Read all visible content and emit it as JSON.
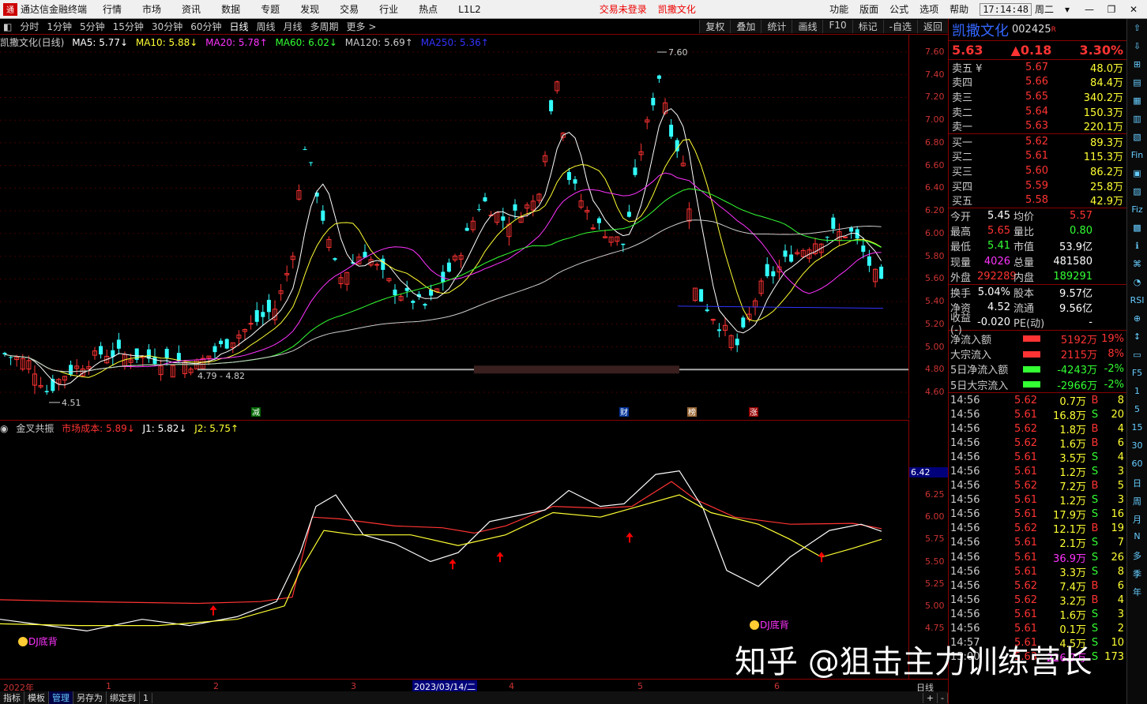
{
  "topbar": {
    "logo": "通",
    "app_name": "通达信金融终端",
    "menus": [
      "行情",
      "市场",
      "资讯",
      "数据",
      "专题",
      "发现",
      "交易",
      "行业",
      "热点",
      "L1L2"
    ],
    "status_login": "交易未登录",
    "status_stock": "凯撒文化",
    "right_menus": [
      "功能",
      "版面",
      "公式",
      "选项",
      "帮助"
    ],
    "time": "17:14:48",
    "weekday": "周二",
    "win_buttons": [
      "▾",
      "—",
      "❐",
      "✕"
    ]
  },
  "periodbar": {
    "toggle": "◧",
    "periods": [
      "分时",
      "1分钟",
      "5分钟",
      "15分钟",
      "30分钟",
      "60分钟",
      "日线",
      "周线",
      "月线",
      "多周期",
      "更多 >"
    ],
    "active": "日线",
    "tools": [
      "复权",
      "叠加",
      "统计",
      "画线",
      "F10",
      "标记",
      "-自选",
      "返回"
    ]
  },
  "ma_line": {
    "name": "凯撒文化(日线)",
    "items": [
      {
        "label": "MA5: 5.77↓",
        "color": "#ffffff"
      },
      {
        "label": "MA10: 5.88↓",
        "color": "#ffff33"
      },
      {
        "label": "MA20: 5.78↑",
        "color": "#ff33ff"
      },
      {
        "label": "MA60: 6.02↓",
        "color": "#33ff33"
      },
      {
        "label": "MA120: 5.69↑",
        "color": "#cccccc"
      },
      {
        "label": "MA250: 5.36↑",
        "color": "#3333ff"
      }
    ]
  },
  "price_axis": [
    "7.60",
    "7.40",
    "7.20",
    "7.00",
    "6.80",
    "6.60",
    "6.40",
    "6.20",
    "6.00",
    "5.80",
    "5.60",
    "5.40",
    "5.20",
    "5.00",
    "4.80",
    "4.60"
  ],
  "annotations": {
    "high": "7.60",
    "low": "4.51",
    "range": "4.79 - 4.82",
    "event_tags": [
      "减",
      "财",
      "榜",
      "涨"
    ]
  },
  "indicator": {
    "toggle": "◉",
    "name": "金叉共振",
    "items": [
      {
        "label": "市场成本: 5.89↓",
        "color": "#ff3333"
      },
      {
        "label": "J1: 5.82↓",
        "color": "#ffffff"
      },
      {
        "label": "J2: 5.75↑",
        "color": "#ffff33"
      }
    ],
    "axis": [
      "6.25",
      "6.00",
      "5.75",
      "5.50",
      "5.25",
      "5.00",
      "4.75"
    ],
    "highlight": "6.42",
    "bottom_signal": "DJ底背"
  },
  "dateaxis": {
    "labels": [
      "2022年",
      "1",
      "2",
      "3",
      "4",
      "5",
      "6"
    ],
    "selected": "2023/03/14/二",
    "period": "日线"
  },
  "bottombar": [
    "指标",
    "模板",
    "管理",
    "另存为",
    "绑定到",
    "1"
  ],
  "bottombar_active": "管理",
  "bottombar_right": [
    "+",
    "-"
  ],
  "quote": {
    "name": "凯撒文化",
    "code": "002425",
    "sup": "R",
    "price": "5.63",
    "change": "▲0.18",
    "pct": "3.30%",
    "sells": [
      {
        "label": "卖五 ¥",
        "price": "5.67",
        "vol": "48.0万"
      },
      {
        "label": "卖四",
        "price": "5.66",
        "vol": "84.4万"
      },
      {
        "label": "卖三",
        "price": "5.65",
        "vol": "340.2万"
      },
      {
        "label": "卖二",
        "price": "5.64",
        "vol": "150.3万"
      },
      {
        "label": "卖一",
        "price": "5.63",
        "vol": "220.1万"
      }
    ],
    "buys": [
      {
        "label": "买一",
        "price": "5.62",
        "vol": "89.3万"
      },
      {
        "label": "买二",
        "price": "5.61",
        "vol": "115.3万"
      },
      {
        "label": "买三",
        "price": "5.60",
        "vol": "86.2万"
      },
      {
        "label": "买四",
        "price": "5.59",
        "vol": "25.8万"
      },
      {
        "label": "买五",
        "price": "5.58",
        "vol": "42.9万"
      }
    ],
    "stats": [
      {
        "a": "今开",
        "b": "5.45",
        "bc": "#ffffff",
        "c": "均价",
        "d": "5.57",
        "dc": "#ff3333"
      },
      {
        "a": "最高",
        "b": "5.65",
        "bc": "#ff3333",
        "c": "量比",
        "d": "0.80",
        "dc": "#33ff33"
      },
      {
        "a": "最低",
        "b": "5.41",
        "bc": "#33ff33",
        "c": "市值",
        "d": "53.9亿",
        "dc": "#ffffff"
      },
      {
        "a": "现量",
        "b": "4026",
        "bc": "#ff33ff",
        "c": "总量",
        "d": "481580",
        "dc": "#ffffff"
      },
      {
        "a": "外盘",
        "b": "292289",
        "bc": "#ff3333",
        "c": "内盘",
        "d": "189291",
        "dc": "#33ff33"
      }
    ],
    "stats2": [
      {
        "a": "换手",
        "b": "5.04%",
        "bc": "#ffffff",
        "c": "股本",
        "d": "9.57亿",
        "dc": "#ffffff"
      },
      {
        "a": "净资",
        "b": "4.52",
        "bc": "#ffffff",
        "c": "流通",
        "d": "9.56亿",
        "dc": "#ffffff"
      },
      {
        "a": "收益(-)",
        "b": "-0.020",
        "bc": "#ffffff",
        "c": "PE(动)",
        "d": "-",
        "dc": "#ffffff"
      }
    ],
    "flows": [
      {
        "l": "净流入额",
        "color": "#ff3333",
        "v": "5192万",
        "p": "19%"
      },
      {
        "l": "大宗流入",
        "color": "#ff3333",
        "v": "2115万",
        "p": "8%"
      },
      {
        "l": "5日净流入额",
        "color": "#33ff33",
        "v": "-4243万",
        "p": "-2%"
      },
      {
        "l": "5日大宗流入",
        "color": "#33ff33",
        "v": "-2966万",
        "p": "-2%"
      }
    ],
    "ticks": [
      [
        "14:56",
        "5.62",
        "0.7万",
        "B",
        "8"
      ],
      [
        "14:56",
        "5.61",
        "16.8万",
        "S",
        "20"
      ],
      [
        "14:56",
        "5.62",
        "1.8万",
        "B",
        "4"
      ],
      [
        "14:56",
        "5.62",
        "1.6万",
        "B",
        "6"
      ],
      [
        "14:56",
        "5.61",
        "3.5万",
        "S",
        "4"
      ],
      [
        "14:56",
        "5.61",
        "1.2万",
        "S",
        "3"
      ],
      [
        "14:56",
        "5.62",
        "7.2万",
        "B",
        "5"
      ],
      [
        "14:56",
        "5.61",
        "1.2万",
        "S",
        "3"
      ],
      [
        "14:56",
        "5.61",
        "17.9万",
        "S",
        "16"
      ],
      [
        "14:56",
        "5.62",
        "12.1万",
        "B",
        "19"
      ],
      [
        "14:56",
        "5.61",
        "2.1万",
        "S",
        "7"
      ],
      [
        "14:56",
        "5.61",
        "36.9万",
        "S",
        "26"
      ],
      [
        "14:56",
        "5.61",
        "3.3万",
        "S",
        "8"
      ],
      [
        "14:56",
        "5.62",
        "7.4万",
        "B",
        "6"
      ],
      [
        "14:56",
        "5.62",
        "3.2万",
        "B",
        "4"
      ],
      [
        "14:56",
        "5.61",
        "1.6万",
        "S",
        "3"
      ],
      [
        "14:56",
        "5.61",
        "0.1万",
        "S",
        "2"
      ],
      [
        "14:57",
        "5.61",
        "4.5万",
        "S",
        "10"
      ],
      [
        "15:00",
        "5.63",
        "226.7万",
        "S",
        "173"
      ]
    ]
  },
  "side_items": [
    "⇧",
    "⇩",
    "⊞",
    "▤",
    "▦",
    "▥",
    "▧",
    "Fin",
    "▣",
    "▨",
    "Fiz",
    "▩",
    "ℹ",
    "⌘",
    "◔",
    "RSI",
    "⊕",
    "↕",
    "▭",
    "F5",
    "1",
    "5",
    "15",
    "30",
    "60",
    "日",
    "周",
    "月",
    "N",
    "多",
    "季",
    "年"
  ],
  "watermark": "知乎 @狙击主力训练营长"
}
